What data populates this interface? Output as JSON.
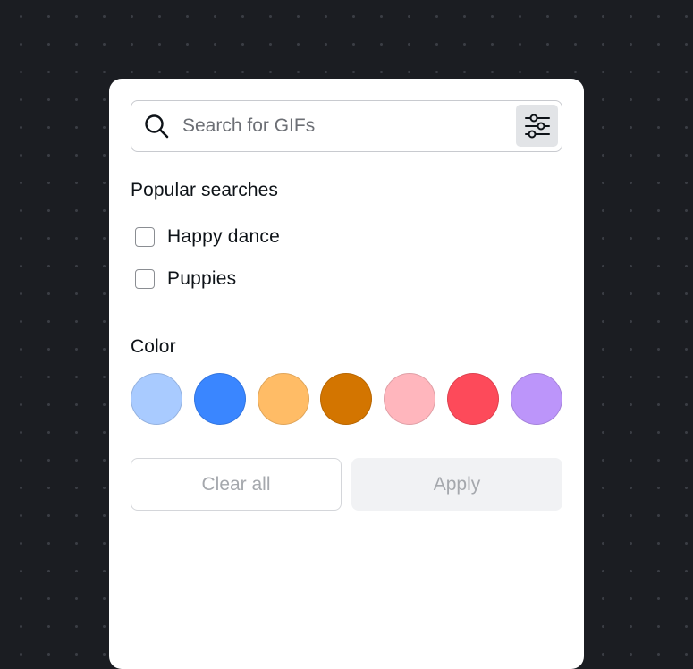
{
  "search": {
    "placeholder": "Search for GIFs",
    "value": ""
  },
  "popular": {
    "title": "Popular searches",
    "items": [
      {
        "label": "Happy dance",
        "checked": false
      },
      {
        "label": "Puppies",
        "checked": false
      }
    ]
  },
  "color": {
    "title": "Color",
    "swatches": [
      "#a9cbff",
      "#3a86ff",
      "#ffbc66",
      "#d37500",
      "#ffb6bd",
      "#fd4a5a",
      "#bc95fa"
    ]
  },
  "actions": {
    "clear_label": "Clear all",
    "apply_label": "Apply"
  },
  "icons": {
    "search": "search-icon",
    "filter": "sliders-icon"
  }
}
